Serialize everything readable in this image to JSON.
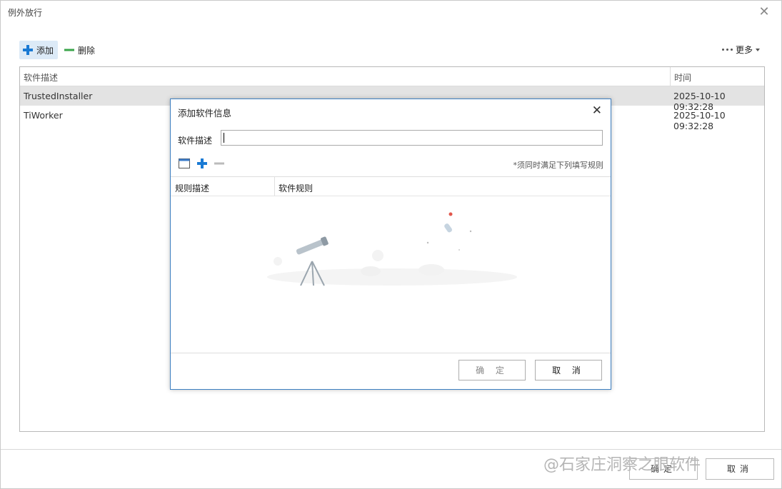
{
  "window": {
    "title": "例外放行",
    "close_glyph": "✕"
  },
  "toolbar": {
    "add_label": "添加",
    "delete_label": "删除",
    "more_label": "更多"
  },
  "table": {
    "columns": [
      "软件描述",
      "时间"
    ],
    "rows": [
      {
        "desc": "TrustedInstaller",
        "time": "2025-10-10 09:32:28"
      },
      {
        "desc": "TiWorker",
        "time": "2025-10-10 09:32:28"
      }
    ]
  },
  "footer": {
    "ok_label": "确定",
    "cancel_label": "取消"
  },
  "watermark": "@石家庄洞察之眼软件",
  "dialog": {
    "title": "添加软件信息",
    "close_glyph": "✕",
    "desc_label": "软件描述",
    "desc_value": "",
    "hint": "*须同时满足下列填写规则",
    "columns": [
      "规则描述",
      "软件规则"
    ],
    "ok_label": "确 定",
    "cancel_label": "取 消"
  },
  "colors": {
    "accent": "#1a7ad4",
    "delete_green": "#3aa54a",
    "dialog_border": "#3d7fc1"
  }
}
